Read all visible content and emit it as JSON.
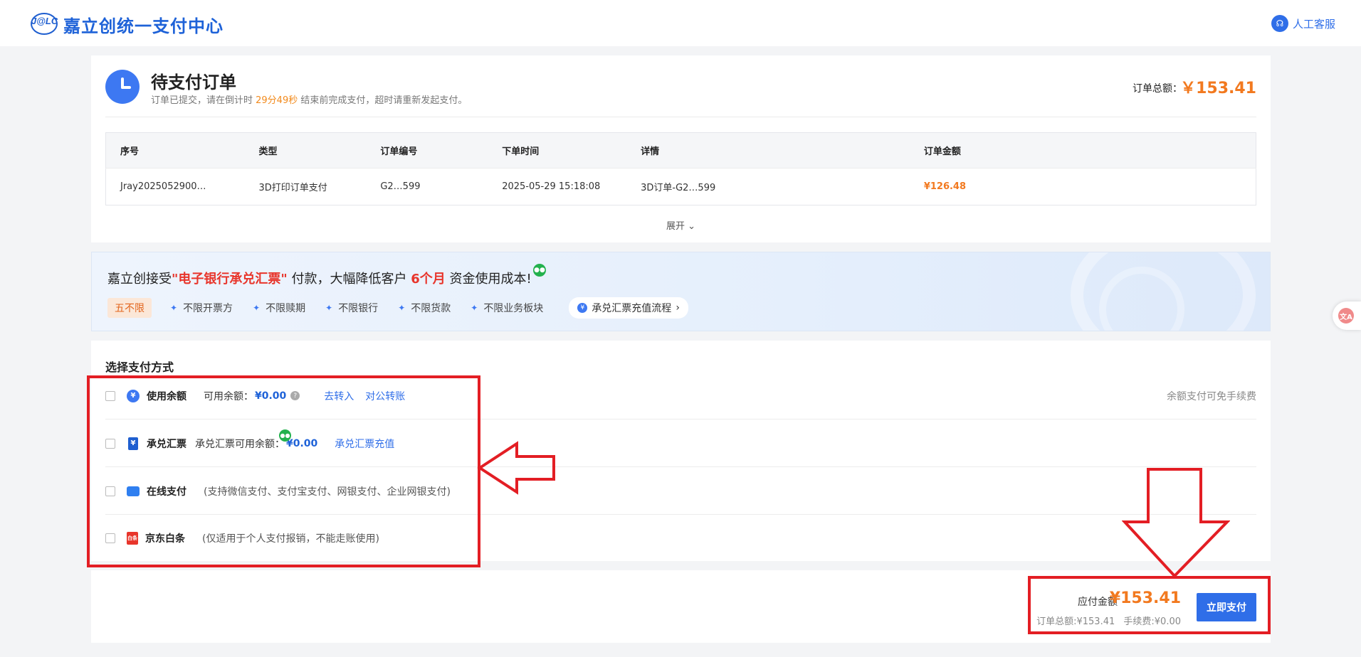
{
  "header": {
    "logo_text": "J@LC",
    "brand": "嘉立创统一支付中心",
    "support_label": "人工客服"
  },
  "order": {
    "title": "待支付订单",
    "sub_prefix": "订单已提交，请在倒计时 ",
    "countdown": "29分49秒",
    "sub_suffix": " 结束前完成支付，超时请重新发起支付。",
    "total_label": "订单总额：",
    "total_value": "￥153.41",
    "table": {
      "headers": [
        "序号",
        "类型",
        "订单编号",
        "下单时间",
        "详情",
        "订单金额"
      ],
      "row": [
        "Jray2025052900…",
        "3D打印订单支付",
        "G2…599",
        "2025-05-29 15:18:08",
        "3D订单-G2…599",
        "¥126.48"
      ]
    },
    "expand_label": "展开 ⌄"
  },
  "banner": {
    "title_prefix": "嘉立创接受",
    "title_highlight": "\"电子银行承兑汇票\"",
    "title_mid": "付款，大幅降低客户 ",
    "title_months": "6个月",
    "title_suffix": " 资金使用成本!",
    "tag": "五不限",
    "features": [
      "不限开票方",
      "不限赎期",
      "不限银行",
      "不限货款",
      "不限业务板块"
    ],
    "flow_button": "承兑汇票充值流程"
  },
  "payment": {
    "section_title": "选择支付方式",
    "balance": {
      "name": "使用余额",
      "available_label": "可用余额：",
      "available_value": "¥0.00",
      "link_transfer_in": "去转入",
      "link_corporate": "对公转账",
      "note": "余额支付可免手续费"
    },
    "acceptance": {
      "name": "承兑汇票",
      "available_label": "承兑汇票可用余额：",
      "available_value": "¥0.00",
      "link_recharge": "承兑汇票充值"
    },
    "online": {
      "name": "在线支付",
      "desc": "(支持微信支付、支付宝支付、网银支付、企业网银支付)"
    },
    "jd": {
      "name": "京东白条",
      "desc": "(仅适用于个人支付报销，不能走账使用)"
    }
  },
  "footer": {
    "due_label": "应付金额",
    "due_value": "¥153.41",
    "total_line": "订单总额:¥153.41",
    "fee_line": "手续费:¥0.00",
    "pay_button": "立即支付"
  },
  "colors": {
    "accent": "#2f6ee8",
    "orange": "#f2791f",
    "annotation_red": "#e31e24"
  }
}
